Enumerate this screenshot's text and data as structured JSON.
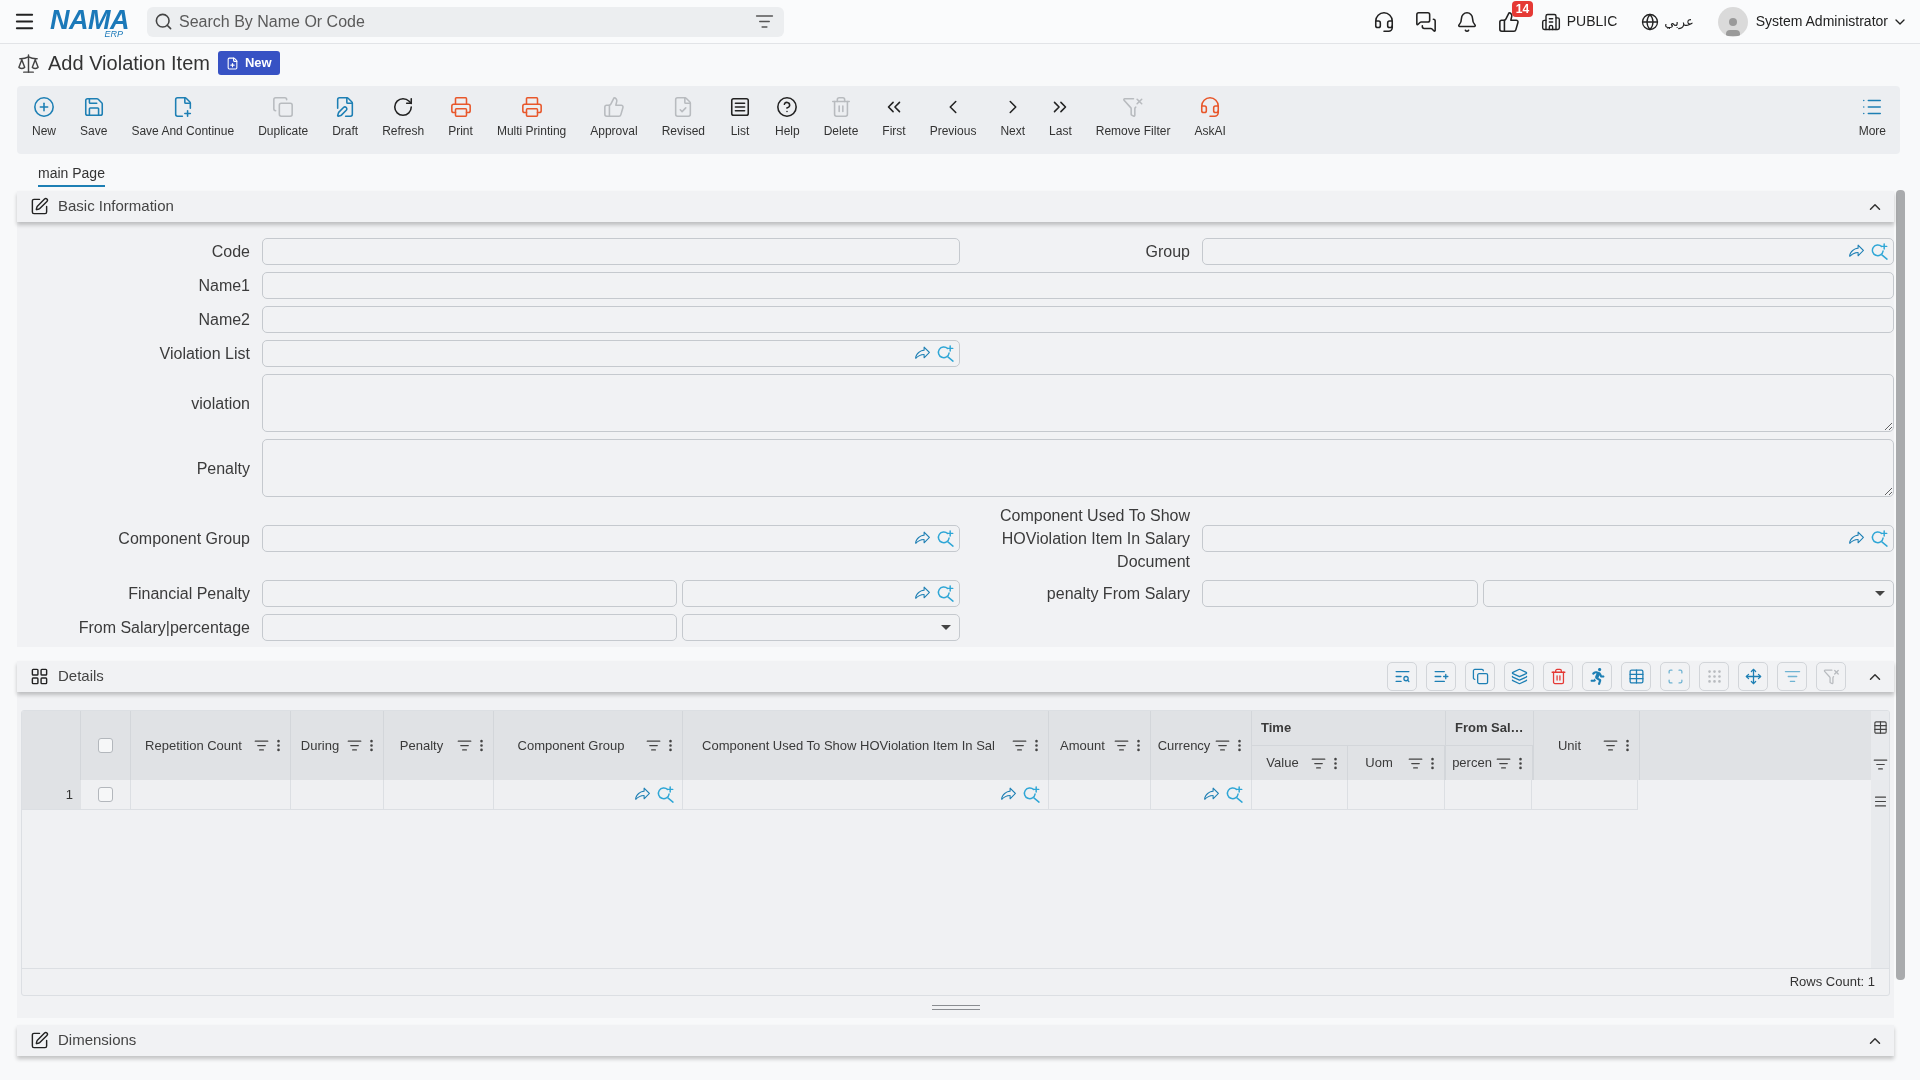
{
  "top_bar": {
    "logo": {
      "text": "NAMA",
      "subtext": "ERP"
    },
    "search": {
      "placeholder": "Search By Name Or Code"
    },
    "notification_count": "14",
    "company": "PUBLIC",
    "language": "عربي",
    "user": "System Administrator"
  },
  "page": {
    "title": "Add Violation Item",
    "status": "New"
  },
  "toolbar": {
    "actions": [
      {
        "label": "New",
        "disabled": false
      },
      {
        "label": "Save",
        "disabled": false
      },
      {
        "label": "Save And Continue",
        "disabled": false
      },
      {
        "label": "Duplicate",
        "disabled": true
      },
      {
        "label": "Draft",
        "disabled": false
      },
      {
        "label": "Refresh",
        "disabled": false
      },
      {
        "label": "Print",
        "disabled": false
      },
      {
        "label": "Multi Printing",
        "disabled": false
      },
      {
        "label": "Approval",
        "disabled": true
      },
      {
        "label": "Revised",
        "disabled": true
      },
      {
        "label": "List",
        "disabled": false
      },
      {
        "label": "Help",
        "disabled": false
      },
      {
        "label": "Delete",
        "disabled": true
      },
      {
        "label": "First",
        "disabled": false
      },
      {
        "label": "Previous",
        "disabled": false
      },
      {
        "label": "Next",
        "disabled": false
      },
      {
        "label": "Last",
        "disabled": false
      },
      {
        "label": "Remove Filter",
        "disabled": true
      },
      {
        "label": "AskAI",
        "disabled": false
      }
    ],
    "more": "More"
  },
  "tabs": [
    {
      "label": "main Page",
      "selected": true
    }
  ],
  "basic_information": {
    "title": "Basic Information",
    "expanded": true,
    "rows": [
      {
        "fields": [
          {
            "label": "Code",
            "kind": "text"
          },
          {
            "label": "Group",
            "kind": "lookup"
          }
        ]
      },
      {
        "fields": [
          {
            "label": "Name1",
            "kind": "text-wide"
          }
        ]
      },
      {
        "fields": [
          {
            "label": "Name2",
            "kind": "text-wide"
          }
        ]
      },
      {
        "fields": [
          {
            "label": "Violation List",
            "kind": "lookup"
          }
        ]
      },
      {
        "fields": [
          {
            "label": "violation",
            "kind": "textarea"
          }
        ]
      },
      {
        "fields": [
          {
            "label": "Penalty",
            "kind": "textarea"
          }
        ]
      },
      {
        "fields": [
          {
            "label": "Component Group",
            "kind": "lookup"
          },
          {
            "label": "Component Used To Show HOViolation Item In Salary Document",
            "kind": "lookup"
          }
        ]
      },
      {
        "fields": [
          {
            "label": "Financial Penalty",
            "kind": "input-lookup"
          },
          {
            "label": "penalty From Salary",
            "kind": "input-select"
          }
        ]
      },
      {
        "fields": [
          {
            "label": "From Salary|percentage",
            "kind": "input-select"
          }
        ]
      }
    ]
  },
  "details": {
    "title": "Details",
    "expanded": true,
    "tools": [
      {
        "disabled": false
      },
      {
        "disabled": false
      },
      {
        "disabled": false
      },
      {
        "disabled": false
      },
      {
        "disabled": false
      },
      {
        "disabled": false
      },
      {
        "disabled": false
      },
      {
        "disabled": false
      },
      {
        "disabled": true
      },
      {
        "disabled": false
      },
      {
        "disabled": false
      },
      {
        "disabled": true
      }
    ],
    "table": {
      "header_checked": false,
      "columns": [
        {
          "label": "Repetition Count",
          "kind": "text"
        },
        {
          "label": "During",
          "kind": "text"
        },
        {
          "label": "Penalty",
          "kind": "text"
        },
        {
          "label": "Component Group",
          "kind": "lookup"
        },
        {
          "label": "Component Used To Show HOViolation Item In Sal",
          "kind": "lookup"
        },
        {
          "label": "Amount",
          "kind": "text"
        },
        {
          "label": "Currency",
          "kind": "lookup"
        },
        {
          "label": "Time",
          "children": [
            {
              "label": "Value",
              "kind": "text"
            },
            {
              "label": "Uom",
              "kind": "text"
            }
          ]
        },
        {
          "label": "From Sal…",
          "children": [
            {
              "label": "percen",
              "kind": "text"
            }
          ]
        },
        {
          "label": "Unit",
          "kind": "text"
        }
      ],
      "rows": [
        {
          "number": "1",
          "checked": false
        }
      ],
      "rows_count": "Rows Count: 1"
    }
  },
  "dimensions": {
    "title": "Dimensions",
    "expanded": true
  }
}
